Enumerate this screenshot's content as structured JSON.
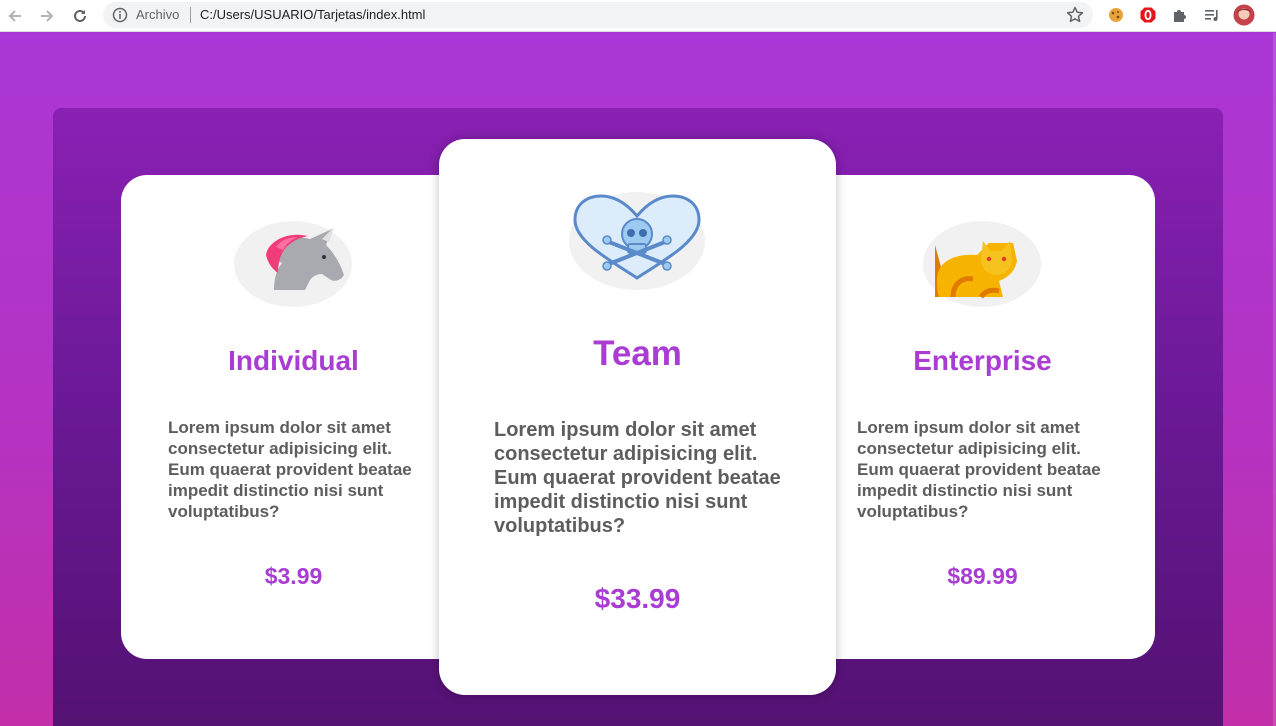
{
  "browser": {
    "origin_label": "Archivo",
    "url": "C:/Users/USUARIO/Tarjetas/index.html",
    "icons": [
      "back-arrow-icon",
      "forward-arrow-icon",
      "reload-icon",
      "info-icon",
      "star-icon",
      "extension-cookie-icon",
      "extension-adblock-icon",
      "puzzle-icon",
      "media-queue-icon",
      "profile-avatar-icon"
    ]
  },
  "colors": {
    "accent_purple": "#a93cd3",
    "body_text": "#5d5d5d",
    "panel_top": "#8a20b4",
    "panel_bottom": "#521170"
  },
  "cards": [
    {
      "title": "Individual",
      "icon": "unicorn-icon",
      "description": "Lorem ipsum dolor sit amet consectetur adipisicing elit. Eum quaerat provident beatae impedit distinctio nisi sunt voluptatibus?",
      "price": "$3.99"
    },
    {
      "title": "Team",
      "icon": "skull-heart-icon",
      "description": "Lorem ipsum dolor sit amet consectetur adipisicing elit. Eum quaerat provident beatae impedit distinctio nisi sunt voluptatibus?",
      "price": "$33.99"
    },
    {
      "title": "Enterprise",
      "icon": "cat-icon",
      "description": "Lorem ipsum dolor sit amet consectetur adipisicing elit. Eum quaerat provident beatae impedit distinctio nisi sunt voluptatibus?",
      "price": "$89.99"
    }
  ]
}
